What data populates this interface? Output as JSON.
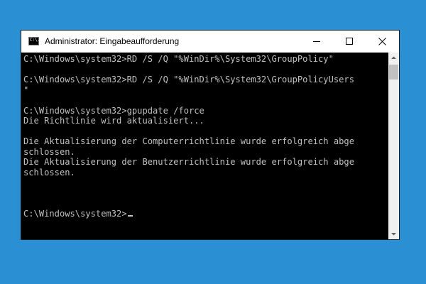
{
  "window": {
    "title": "Administrator: Eingabeaufforderung",
    "icon_glyph": "C:\\."
  },
  "console": {
    "lines": [
      "C:\\Windows\\system32>RD /S /Q \"%WinDir%\\System32\\GroupPolicy\"",
      "",
      "C:\\Windows\\system32>RD /S /Q \"%WinDir%\\System32\\GroupPolicyUsers",
      "\"",
      "",
      "C:\\Windows\\system32>gpupdate /force",
      "Die Richtlinie wird aktualisiert...",
      "",
      "Die Aktualisierung der Computerrichtlinie wurde erfolgreich abge",
      "schlossen.",
      "Die Aktualisierung der Benutzerrichtlinie wurde erfolgreich abge",
      "schlossen.",
      "",
      "",
      "",
      "C:\\Windows\\system32>"
    ]
  },
  "colors": {
    "desktop": "#2b8fd3",
    "console_bg": "#000000",
    "console_text": "#c0c0c0",
    "titlebar": "#ffffff"
  },
  "icons": {
    "app": "cmd-icon",
    "minimize": "minimize-icon",
    "maximize": "maximize-icon",
    "close": "close-icon"
  }
}
